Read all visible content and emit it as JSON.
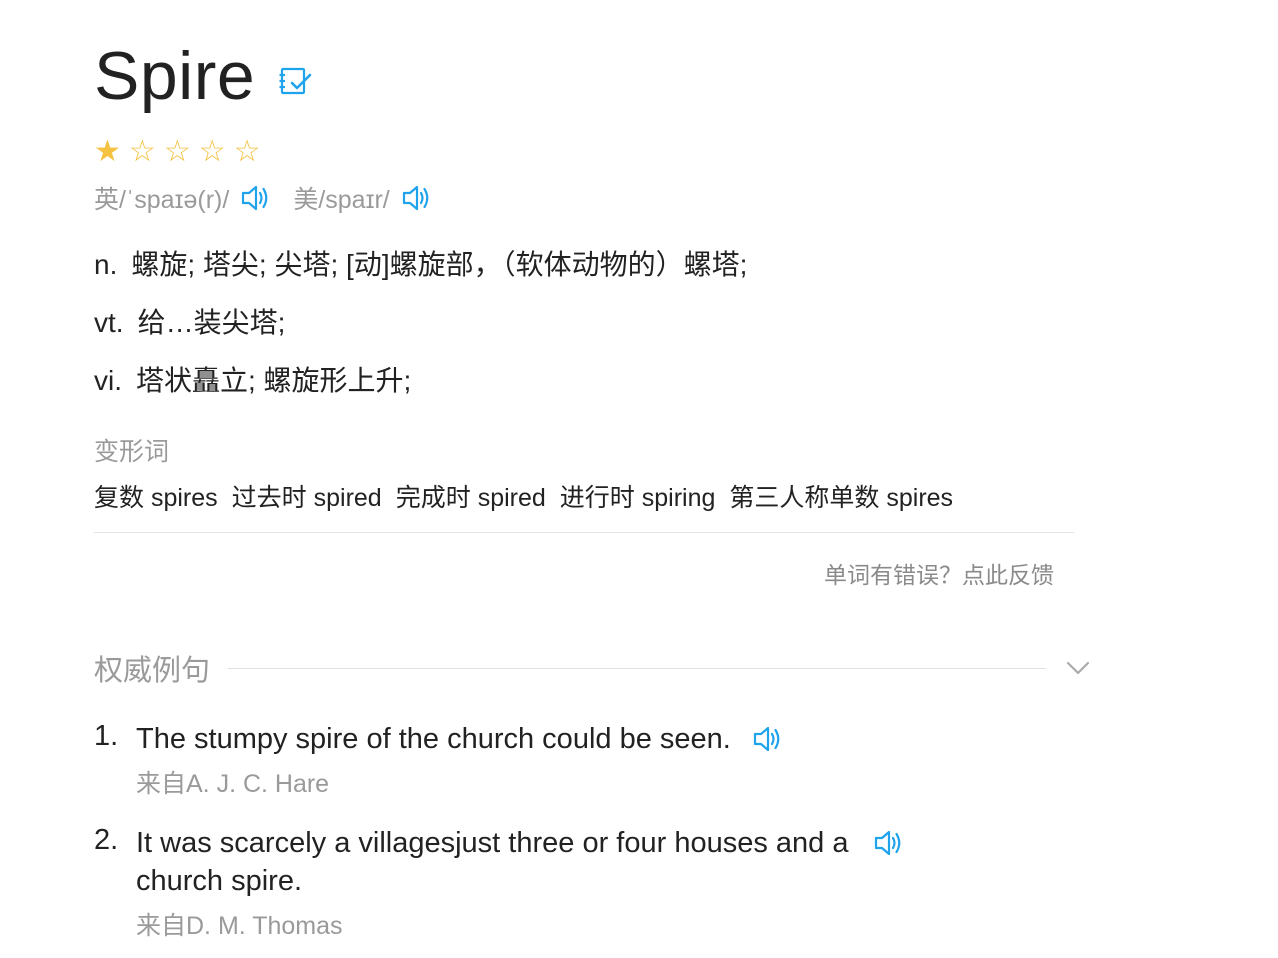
{
  "word": {
    "headword": "Spire",
    "rating_stars_filled": 1,
    "rating_stars_total": 5,
    "stars": [
      "★",
      "☆",
      "☆",
      "☆",
      "☆"
    ]
  },
  "phonetics": {
    "uk": "英/ˈspaɪə(r)/",
    "us": "美/spaɪr/"
  },
  "definitions": [
    {
      "pos": "n.",
      "text": "螺旋; 塔尖; 尖塔; [动]螺旋部，（软体动物的）螺塔;"
    },
    {
      "pos": "vt.",
      "text": "给…装尖塔;"
    },
    {
      "pos": "vi.",
      "text": "塔状矗立; 螺旋形上升;"
    }
  ],
  "word_forms": {
    "title": "变形词",
    "items": [
      {
        "label": "复数",
        "value": "spires"
      },
      {
        "label": "过去时",
        "value": "spired"
      },
      {
        "label": "完成时",
        "value": "spired"
      },
      {
        "label": "进行时",
        "value": "spiring"
      },
      {
        "label": "第三人称单数",
        "value": "spires"
      }
    ]
  },
  "feedback": {
    "label": "单词有错误？点此反馈"
  },
  "examples": {
    "title": "权威例句",
    "items": [
      {
        "num": "1.",
        "lines": [
          "The stumpy spire of the church could be seen."
        ],
        "source": "来自A. J. C. Hare"
      },
      {
        "num": "2.",
        "lines": [
          "It was scarcely a villagesjust three or four houses and a",
          "church spire."
        ],
        "source": "来自D. M. Thomas"
      }
    ]
  },
  "colors": {
    "accent": "#1fa3ec",
    "star": "#f5c242",
    "muted": "#9a9a9a"
  }
}
